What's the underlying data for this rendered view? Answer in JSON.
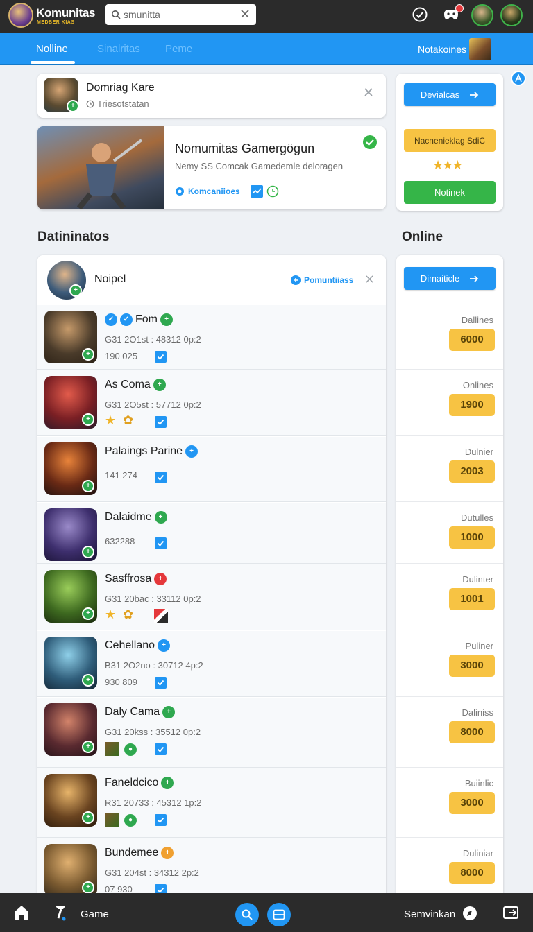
{
  "app": {
    "brand": "Komunitas",
    "brand_sub": "MEDBER KIAS"
  },
  "search": {
    "value": "smunitta"
  },
  "nav": {
    "tabs": [
      {
        "label": "Nolline",
        "active": true
      },
      {
        "label": "Sinalritas",
        "active": false
      },
      {
        "label": "Peme",
        "active": false
      }
    ],
    "user_label": "Notakoines"
  },
  "profile_card": {
    "title": "Domriag Kare",
    "subtitle": "Triesotstatan"
  },
  "feature_card": {
    "title": "Nomumitas Gamergögun",
    "desc": "Nemy SS Comcak Gamedemle deloragen",
    "link": "Komcaniioes"
  },
  "side_top": {
    "blue_button": "Devialcas",
    "yellow_button": "Nacnenieklag SdiC",
    "green_button": "Notinek",
    "rating": 3
  },
  "section_left": "Datininatos",
  "section_right": "Online",
  "list_header": {
    "title": "Noipel",
    "link": "Pomuntiiass"
  },
  "side_list_button": "Dimaiticle",
  "rows": [
    {
      "name": "Fom",
      "meta": "G31 2O1st : 48312 0p:2",
      "sub": "190 025",
      "online_label": "Dallines",
      "online_value": "6000"
    },
    {
      "name": "As Coma",
      "meta": "G31 2O5st : 57712 0p:2",
      "sub": "",
      "online_label": "Onlines",
      "online_value": "1900"
    },
    {
      "name": "Palaings Parine",
      "meta": "",
      "sub": "141 274",
      "online_label": "Dulnier",
      "online_value": "2003"
    },
    {
      "name": "Dalaidme",
      "meta": "",
      "sub": "632288",
      "online_label": "Dutulles",
      "online_value": "1000"
    },
    {
      "name": "Sasffrosa",
      "meta": "G31 20bac : 33112 0p:2",
      "sub": "",
      "online_label": "Dulinter",
      "online_value": "1001"
    },
    {
      "name": "Cehellano",
      "meta": "B31 2O2no : 30712 4p:2",
      "sub": "930 809",
      "online_label": "Puliner",
      "online_value": "3000"
    },
    {
      "name": "Daly Cama",
      "meta": "G31 20kss : 35512 0p:2",
      "sub": "",
      "online_label": "Daliniss",
      "online_value": "8000"
    },
    {
      "name": "Faneldcico",
      "meta": "R31 20733 : 45312 1p:2",
      "sub": "",
      "online_label": "Buiinlic",
      "online_value": "3000"
    },
    {
      "name": "Bundemee",
      "meta": "G31 204st : 34312 2p:2",
      "sub": "07 930",
      "online_label": "Duliniar",
      "online_value": "8000"
    }
  ],
  "bottom": {
    "game": "Game",
    "right": "Semvinkan"
  },
  "icons": [
    "search-icon",
    "close-icon",
    "check-circle-icon",
    "gamepad-icon",
    "home-icon",
    "hammer-icon",
    "layout-icon",
    "arrow-right-icon",
    "star-icon",
    "exit-icon"
  ]
}
